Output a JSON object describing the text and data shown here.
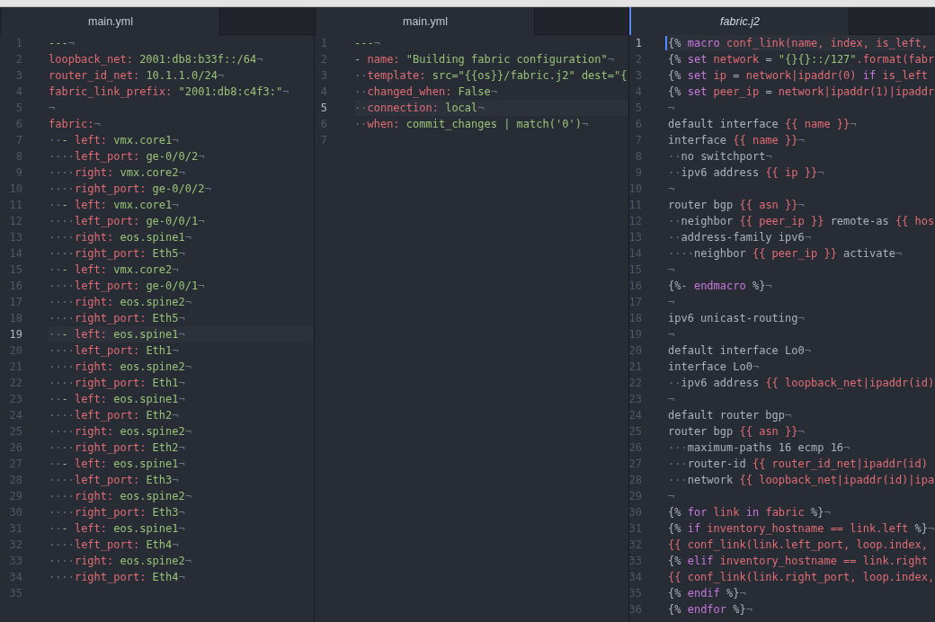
{
  "panes": [
    {
      "tab": {
        "label": "main.yml",
        "selected": false,
        "preview": false
      },
      "lines": [
        {
          "number": "1",
          "current": false,
          "tokens": [
            {
              "kind": "value",
              "text": "---"
            }
          ],
          "end_mark": "¬"
        },
        {
          "number": "2",
          "current": false,
          "tokens": [
            {
              "kind": "key",
              "text": "loopback_net:"
            },
            {
              "kind": "value",
              "text": " 2001:db8:b33f::/64"
            }
          ],
          "end_mark": "¬"
        },
        {
          "number": "3",
          "current": false,
          "tokens": [
            {
              "kind": "key",
              "text": "router_id_net:"
            },
            {
              "kind": "value",
              "text": " 10.1.1.0/24"
            }
          ],
          "end_mark": "¬"
        },
        {
          "number": "4",
          "current": false,
          "tokens": [
            {
              "kind": "key",
              "text": "fabric_link_prefix:"
            },
            {
              "kind": "value",
              "text": " \"2001:db8:c4f3:\""
            }
          ],
          "end_mark": "¬"
        },
        {
          "number": "5",
          "current": false,
          "end_mark": "¬"
        },
        {
          "number": "6",
          "current": false,
          "tokens": [
            {
              "kind": "key",
              "text": "fabric:"
            }
          ],
          "end_mark": "¬"
        },
        {
          "number": "7",
          "current": false,
          "indent_marks": "··",
          "tokens": [
            {
              "kind": "value",
              "text": "- "
            },
            {
              "kind": "key",
              "text": "left:"
            },
            {
              "kind": "value",
              "text": " vmx.core1"
            }
          ],
          "end_mark": "¬"
        },
        {
          "number": "8",
          "current": false,
          "indent_marks": "····",
          "tokens": [
            {
              "kind": "key",
              "text": "left_port:"
            },
            {
              "kind": "value",
              "text": " ge-0/0/2"
            }
          ],
          "end_mark": "¬"
        },
        {
          "number": "9",
          "current": false,
          "indent_marks": "····",
          "tokens": [
            {
              "kind": "key",
              "text": "right:"
            },
            {
              "kind": "value",
              "text": " vmx.core2"
            }
          ],
          "end_mark": "¬"
        },
        {
          "number": "10",
          "current": false,
          "indent_marks": "····",
          "tokens": [
            {
              "kind": "key",
              "text": "right_port:"
            },
            {
              "kind": "value",
              "text": " ge-0/0/2"
            }
          ],
          "end_mark": "¬"
        },
        {
          "number": "11",
          "current": false,
          "indent_marks": "··",
          "tokens": [
            {
              "kind": "value",
              "text": "- "
            },
            {
              "kind": "key",
              "text": "left:"
            },
            {
              "kind": "value",
              "text": " vmx.core1"
            }
          ],
          "end_mark": "¬"
        },
        {
          "number": "12",
          "current": false,
          "indent_marks": "····",
          "tokens": [
            {
              "kind": "key",
              "text": "left_port:"
            },
            {
              "kind": "value",
              "text": " ge-0/0/1"
            }
          ],
          "end_mark": "¬"
        },
        {
          "number": "13",
          "current": false,
          "indent_marks": "····",
          "tokens": [
            {
              "kind": "key",
              "text": "right:"
            },
            {
              "kind": "value",
              "text": " eos.spine1"
            }
          ],
          "end_mark": "¬"
        },
        {
          "number": "14",
          "current": false,
          "indent_marks": "····",
          "tokens": [
            {
              "kind": "key",
              "text": "right_port:"
            },
            {
              "kind": "value",
              "text": " Eth5"
            }
          ],
          "end_mark": "¬"
        },
        {
          "number": "15",
          "current": false,
          "indent_marks": "··",
          "tokens": [
            {
              "kind": "value",
              "text": "- "
            },
            {
              "kind": "key",
              "text": "left:"
            },
            {
              "kind": "value",
              "text": " vmx.core2"
            }
          ],
          "end_mark": "¬"
        },
        {
          "number": "16",
          "current": false,
          "indent_marks": "····",
          "tokens": [
            {
              "kind": "key",
              "text": "left_port:"
            },
            {
              "kind": "value",
              "text": " ge-0/0/1"
            }
          ],
          "end_mark": "¬"
        },
        {
          "number": "17",
          "current": false,
          "indent_marks": "····",
          "tokens": [
            {
              "kind": "key",
              "text": "right:"
            },
            {
              "kind": "value",
              "text": " eos.spine2"
            }
          ],
          "end_mark": "¬"
        },
        {
          "number": "18",
          "current": false,
          "indent_marks": "····",
          "tokens": [
            {
              "kind": "key",
              "text": "right_port:"
            },
            {
              "kind": "value",
              "text": " Eth5"
            }
          ],
          "end_mark": "¬"
        },
        {
          "number": "19",
          "current": true,
          "indent_marks": "··",
          "tokens": [
            {
              "kind": "value",
              "text": "- "
            },
            {
              "kind": "key",
              "text": "left:"
            },
            {
              "kind": "value",
              "text": " eos.spine1"
            }
          ],
          "end_mark": "¬"
        },
        {
          "number": "20",
          "current": false,
          "indent_marks": "····",
          "tokens": [
            {
              "kind": "key",
              "text": "left_port:"
            },
            {
              "kind": "value",
              "text": " Eth1"
            }
          ],
          "end_mark": "¬"
        },
        {
          "number": "21",
          "current": false,
          "indent_marks": "····",
          "tokens": [
            {
              "kind": "key",
              "text": "right:"
            },
            {
              "kind": "value",
              "text": " eos.spine2"
            }
          ],
          "end_mark": "¬"
        },
        {
          "number": "22",
          "current": false,
          "indent_marks": "····",
          "tokens": [
            {
              "kind": "key",
              "text": "right_port:"
            },
            {
              "kind": "value",
              "text": " Eth1"
            }
          ],
          "end_mark": "¬"
        },
        {
          "number": "23",
          "current": false,
          "indent_marks": "··",
          "tokens": [
            {
              "kind": "value",
              "text": "- "
            },
            {
              "kind": "key",
              "text": "left:"
            },
            {
              "kind": "value",
              "text": " eos.spine1"
            }
          ],
          "end_mark": "¬"
        },
        {
          "number": "24",
          "current": false,
          "indent_marks": "····",
          "tokens": [
            {
              "kind": "key",
              "text": "left_port:"
            },
            {
              "kind": "value",
              "text": " Eth2"
            }
          ],
          "end_mark": "¬"
        },
        {
          "number": "25",
          "current": false,
          "indent_marks": "····",
          "tokens": [
            {
              "kind": "key",
              "text": "right:"
            },
            {
              "kind": "value",
              "text": " eos.spine2"
            }
          ],
          "end_mark": "¬"
        },
        {
          "number": "26",
          "current": false,
          "indent_marks": "····",
          "tokens": [
            {
              "kind": "key",
              "text": "right_port:"
            },
            {
              "kind": "value",
              "text": " Eth2"
            }
          ],
          "end_mark": "¬"
        },
        {
          "number": "27",
          "current": false,
          "indent_marks": "··",
          "tokens": [
            {
              "kind": "value",
              "text": "- "
            },
            {
              "kind": "key",
              "text": "left:"
            },
            {
              "kind": "value",
              "text": " eos.spine1"
            }
          ],
          "end_mark": "¬"
        },
        {
          "number": "28",
          "current": false,
          "indent_marks": "····",
          "tokens": [
            {
              "kind": "key",
              "text": "left_port:"
            },
            {
              "kind": "value",
              "text": " Eth3"
            }
          ],
          "end_mark": "¬"
        },
        {
          "number": "29",
          "current": false,
          "indent_marks": "····",
          "tokens": [
            {
              "kind": "key",
              "text": "right:"
            },
            {
              "kind": "value",
              "text": " eos.spine2"
            }
          ],
          "end_mark": "¬"
        },
        {
          "number": "30",
          "current": false,
          "indent_marks": "····",
          "tokens": [
            {
              "kind": "key",
              "text": "right_port:"
            },
            {
              "kind": "value",
              "text": " Eth3"
            }
          ],
          "end_mark": "¬"
        },
        {
          "number": "31",
          "current": false,
          "indent_marks": "··",
          "tokens": [
            {
              "kind": "value",
              "text": "- "
            },
            {
              "kind": "key",
              "text": "left:"
            },
            {
              "kind": "value",
              "text": " eos.spine1"
            }
          ],
          "end_mark": "¬"
        },
        {
          "number": "32",
          "current": false,
          "indent_marks": "····",
          "tokens": [
            {
              "kind": "key",
              "text": "left_port:"
            },
            {
              "kind": "value",
              "text": " Eth4"
            }
          ],
          "end_mark": "¬"
        },
        {
          "number": "33",
          "current": false,
          "indent_marks": "····",
          "tokens": [
            {
              "kind": "key",
              "text": "right:"
            },
            {
              "kind": "value",
              "text": " eos.spine2"
            }
          ],
          "end_mark": "¬"
        },
        {
          "number": "34",
          "current": false,
          "indent_marks": "····",
          "tokens": [
            {
              "kind": "key",
              "text": "right_port:"
            },
            {
              "kind": "value",
              "text": " Eth4"
            }
          ],
          "end_mark": "¬"
        },
        {
          "number": "35",
          "current": false
        }
      ]
    },
    {
      "tab": {
        "label": "main.yml",
        "selected": false,
        "preview": false
      },
      "lines": [
        {
          "number": "1",
          "current": false,
          "tokens": [
            {
              "kind": "value",
              "text": "---"
            }
          ],
          "end_mark": "¬"
        },
        {
          "number": "2",
          "current": false,
          "tokens": [
            {
              "kind": "plain",
              "text": "- "
            },
            {
              "kind": "key",
              "text": "name:"
            },
            {
              "kind": "value",
              "text": " \"Building fabric configuration\""
            }
          ],
          "end_mark": "¬"
        },
        {
          "number": "3",
          "current": false,
          "indent_marks": "··",
          "tokens": [
            {
              "kind": "key",
              "text": "template:"
            },
            {
              "kind": "value",
              "text": " src=\"{{os}}/fabric.j2\" dest=\"{"
            }
          ]
        },
        {
          "number": "4",
          "current": false,
          "indent_marks": "··",
          "tokens": [
            {
              "kind": "key",
              "text": "changed_when:"
            },
            {
              "kind": "value",
              "text": " False"
            }
          ],
          "end_mark": "¬"
        },
        {
          "number": "5",
          "current": true,
          "indent_marks": "··",
          "tokens": [
            {
              "kind": "key",
              "text": "connection:"
            },
            {
              "kind": "value",
              "text": " local"
            }
          ],
          "end_mark": "¬"
        },
        {
          "number": "6",
          "current": false,
          "indent_marks": "··",
          "tokens": [
            {
              "kind": "key",
              "text": "when:"
            },
            {
              "kind": "value",
              "text": " commit_changes | match('0')"
            }
          ],
          "end_mark": "¬"
        },
        {
          "number": "7",
          "current": false
        }
      ]
    },
    {
      "tab": {
        "label": "fabric.j2",
        "selected": true,
        "preview": true
      },
      "lines": [
        {
          "number": "1",
          "current": true,
          "tokens": [
            {
              "kind": "plain",
              "text": "{% "
            },
            {
              "kind": "keyword",
              "text": "macro"
            },
            {
              "kind": "variable",
              "text": " conf_link(name, index, is_left,"
            }
          ]
        },
        {
          "number": "2",
          "current": false,
          "tokens": [
            {
              "kind": "plain",
              "text": "{% "
            },
            {
              "kind": "keyword",
              "text": "set"
            },
            {
              "kind": "variable",
              "text": " network"
            },
            {
              "kind": "plain",
              "text": " = "
            },
            {
              "kind": "value",
              "text": "\"{}{}::/127\""
            },
            {
              "kind": "variable",
              "text": ".format(fabr"
            }
          ]
        },
        {
          "number": "3",
          "current": false,
          "tokens": [
            {
              "kind": "plain",
              "text": "{% "
            },
            {
              "kind": "keyword",
              "text": "set"
            },
            {
              "kind": "variable",
              "text": " ip"
            },
            {
              "kind": "plain",
              "text": " = "
            },
            {
              "kind": "variable",
              "text": "network|ipaddr(0) "
            },
            {
              "kind": "keyword",
              "text": "if"
            },
            {
              "kind": "variable",
              "text": " is_left"
            }
          ]
        },
        {
          "number": "4",
          "current": false,
          "tokens": [
            {
              "kind": "plain",
              "text": "{% "
            },
            {
              "kind": "keyword",
              "text": "set"
            },
            {
              "kind": "variable",
              "text": " peer_ip"
            },
            {
              "kind": "plain",
              "text": " = "
            },
            {
              "kind": "variable",
              "text": "network|ipaddr(1)|ipaddr"
            }
          ]
        },
        {
          "number": "5",
          "current": false,
          "end_mark": "¬"
        },
        {
          "number": "6",
          "current": false,
          "tokens": [
            {
              "kind": "plain",
              "text": "default interface "
            },
            {
              "kind": "variable",
              "text": "{{ name }}"
            }
          ],
          "end_mark": "¬"
        },
        {
          "number": "7",
          "current": false,
          "tokens": [
            {
              "kind": "plain",
              "text": "interface "
            },
            {
              "kind": "variable",
              "text": "{{ name }}"
            }
          ],
          "end_mark": "¬"
        },
        {
          "number": "8",
          "current": false,
          "indent_marks": "··",
          "tokens": [
            {
              "kind": "plain",
              "text": "no switchport"
            }
          ],
          "end_mark": "¬"
        },
        {
          "number": "9",
          "current": false,
          "indent_marks": "··",
          "tokens": [
            {
              "kind": "plain",
              "text": "ipv6 address "
            },
            {
              "kind": "variable",
              "text": "{{ ip }}"
            }
          ],
          "end_mark": "¬"
        },
        {
          "number": "10",
          "current": false,
          "end_mark": "¬"
        },
        {
          "number": "11",
          "current": false,
          "tokens": [
            {
              "kind": "plain",
              "text": "router bgp "
            },
            {
              "kind": "variable",
              "text": "{{ asn }}"
            }
          ],
          "end_mark": "¬"
        },
        {
          "number": "12",
          "current": false,
          "indent_marks": "··",
          "tokens": [
            {
              "kind": "plain",
              "text": "neighbor "
            },
            {
              "kind": "variable",
              "text": "{{ peer_ip }}"
            },
            {
              "kind": "plain",
              "text": " remote-as "
            },
            {
              "kind": "variable",
              "text": "{{ hos"
            }
          ]
        },
        {
          "number": "13",
          "current": false,
          "indent_marks": "··",
          "tokens": [
            {
              "kind": "plain",
              "text": "address-family ipv6"
            }
          ],
          "end_mark": "¬"
        },
        {
          "number": "14",
          "current": false,
          "indent_marks": "····",
          "tokens": [
            {
              "kind": "plain",
              "text": "neighbor "
            },
            {
              "kind": "variable",
              "text": "{{ peer_ip }}"
            },
            {
              "kind": "plain",
              "text": " activate"
            }
          ],
          "end_mark": "¬"
        },
        {
          "number": "15",
          "current": false,
          "end_mark": "¬"
        },
        {
          "number": "16",
          "current": false,
          "tokens": [
            {
              "kind": "plain",
              "text": "{%- "
            },
            {
              "kind": "keyword",
              "text": "endmacro"
            },
            {
              "kind": "plain",
              "text": " %}"
            }
          ],
          "end_mark": "¬"
        },
        {
          "number": "17",
          "current": false,
          "end_mark": "¬"
        },
        {
          "number": "18",
          "current": false,
          "tokens": [
            {
              "kind": "plain",
              "text": "ipv6 unicast-routing"
            }
          ],
          "end_mark": "¬"
        },
        {
          "number": "19",
          "current": false,
          "end_mark": "¬"
        },
        {
          "number": "20",
          "current": false,
          "tokens": [
            {
              "kind": "plain",
              "text": "default interface Lo0"
            }
          ],
          "end_mark": "¬"
        },
        {
          "number": "21",
          "current": false,
          "tokens": [
            {
              "kind": "plain",
              "text": "interface Lo0"
            }
          ],
          "end_mark": "¬"
        },
        {
          "number": "22",
          "current": false,
          "indent_marks": "··",
          "tokens": [
            {
              "kind": "plain",
              "text": "ipv6 address "
            },
            {
              "kind": "variable",
              "text": "{{ loopback_net|ipaddr(id)"
            }
          ]
        },
        {
          "number": "23",
          "current": false,
          "end_mark": "¬"
        },
        {
          "number": "24",
          "current": false,
          "tokens": [
            {
              "kind": "plain",
              "text": "default router bgp"
            }
          ],
          "end_mark": "¬"
        },
        {
          "number": "25",
          "current": false,
          "tokens": [
            {
              "kind": "plain",
              "text": "router bgp "
            },
            {
              "kind": "variable",
              "text": "{{ asn }}"
            }
          ],
          "end_mark": "¬"
        },
        {
          "number": "26",
          "current": false,
          "indent_marks": "···",
          "tokens": [
            {
              "kind": "plain",
              "text": "maximum-paths 16 ecmp 16"
            }
          ],
          "end_mark": "¬"
        },
        {
          "number": "27",
          "current": false,
          "indent_marks": "···",
          "tokens": [
            {
              "kind": "plain",
              "text": "router-id "
            },
            {
              "kind": "variable",
              "text": "{{ router_id_net|ipaddr(id)"
            }
          ]
        },
        {
          "number": "28",
          "current": false,
          "indent_marks": "···",
          "tokens": [
            {
              "kind": "plain",
              "text": "network "
            },
            {
              "kind": "variable",
              "text": "{{ loopback_net|ipaddr(id)|ipa"
            }
          ]
        },
        {
          "number": "29",
          "current": false,
          "end_mark": "¬"
        },
        {
          "number": "30",
          "current": false,
          "tokens": [
            {
              "kind": "plain",
              "text": "{% "
            },
            {
              "kind": "keyword",
              "text": "for"
            },
            {
              "kind": "variable",
              "text": " link "
            },
            {
              "kind": "keyword",
              "text": "in"
            },
            {
              "kind": "variable",
              "text": " fabric"
            },
            {
              "kind": "plain",
              "text": " %}"
            }
          ],
          "end_mark": "¬"
        },
        {
          "number": "31",
          "current": false,
          "tokens": [
            {
              "kind": "plain",
              "text": "{% "
            },
            {
              "kind": "keyword",
              "text": "if"
            },
            {
              "kind": "variable",
              "text": " inventory_hostname == link.left"
            },
            {
              "kind": "plain",
              "text": " %}"
            }
          ],
          "end_mark": "¬"
        },
        {
          "number": "32",
          "current": false,
          "tokens": [
            {
              "kind": "variable",
              "text": "{{ conf_link(link.left_port, loop.index,"
            }
          ]
        },
        {
          "number": "33",
          "current": false,
          "tokens": [
            {
              "kind": "plain",
              "text": "{% "
            },
            {
              "kind": "keyword",
              "text": "elif"
            },
            {
              "kind": "variable",
              "text": " inventory_hostname == link.right"
            }
          ]
        },
        {
          "number": "34",
          "current": false,
          "tokens": [
            {
              "kind": "variable",
              "text": "{{ conf_link(link.right_port, loop.index,"
            }
          ]
        },
        {
          "number": "35",
          "current": false,
          "tokens": [
            {
              "kind": "plain",
              "text": "{% "
            },
            {
              "kind": "keyword",
              "text": "endif"
            },
            {
              "kind": "plain",
              "text": " %}"
            }
          ],
          "end_mark": "¬"
        },
        {
          "number": "36",
          "current": false,
          "tokens": [
            {
              "kind": "plain",
              "text": "{% "
            },
            {
              "kind": "keyword",
              "text": "endfor"
            },
            {
              "kind": "plain",
              "text": " %}"
            }
          ],
          "end_mark": "¬"
        }
      ]
    }
  ]
}
